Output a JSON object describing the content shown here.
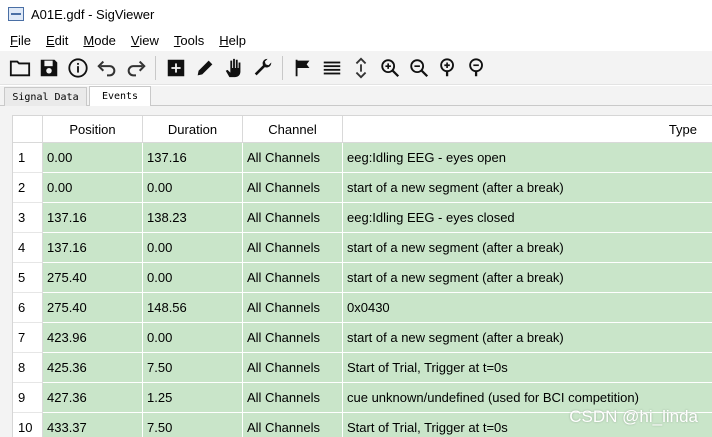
{
  "window": {
    "title": "A01E.gdf - SigViewer"
  },
  "menubar": {
    "items": [
      {
        "label": "File",
        "accel": "F",
        "rest": "ile"
      },
      {
        "label": "Edit",
        "accel": "E",
        "rest": "dit"
      },
      {
        "label": "Mode",
        "accel": "M",
        "rest": "ode"
      },
      {
        "label": "View",
        "accel": "V",
        "rest": "iew"
      },
      {
        "label": "Tools",
        "accel": "T",
        "rest": "ools"
      },
      {
        "label": "Help",
        "accel": "H",
        "rest": "elp"
      }
    ]
  },
  "toolbar": {
    "buttons": [
      "open-folder-icon",
      "save-icon",
      "info-icon",
      "undo-icon",
      "redo-icon",
      "add-event-icon",
      "pencil-icon",
      "hand-icon",
      "wrench-icon",
      "flag-icon",
      "list-icon",
      "vertical-scale-icon",
      "zoom-in-vertical-icon",
      "zoom-out-vertical-icon",
      "zoom-in-icon",
      "zoom-out-icon"
    ]
  },
  "tabs": [
    {
      "label": "Signal Data",
      "active": false
    },
    {
      "label": "Events",
      "active": true
    }
  ],
  "events_table": {
    "columns": [
      "Position",
      "Duration",
      "Channel",
      "Type"
    ],
    "rows": [
      {
        "num": "1",
        "position": "0.00",
        "duration": "137.16",
        "channel": "All Channels",
        "type": "eeg:Idling EEG - eyes open"
      },
      {
        "num": "2",
        "position": "0.00",
        "duration": "0.00",
        "channel": "All Channels",
        "type": "start of a new segment (after a break)"
      },
      {
        "num": "3",
        "position": "137.16",
        "duration": "138.23",
        "channel": "All Channels",
        "type": "eeg:Idling EEG - eyes closed"
      },
      {
        "num": "4",
        "position": "137.16",
        "duration": "0.00",
        "channel": "All Channels",
        "type": "start of a new segment (after a break)"
      },
      {
        "num": "5",
        "position": "275.40",
        "duration": "0.00",
        "channel": "All Channels",
        "type": "start of a new segment (after a break)"
      },
      {
        "num": "6",
        "position": "275.40",
        "duration": "148.56",
        "channel": "All Channels",
        "type": "0x0430"
      },
      {
        "num": "7",
        "position": "423.96",
        "duration": "0.00",
        "channel": "All Channels",
        "type": "start of a new segment (after a break)"
      },
      {
        "num": "8",
        "position": "425.36",
        "duration": "7.50",
        "channel": "All Channels",
        "type": "Start of Trial, Trigger at t=0s"
      },
      {
        "num": "9",
        "position": "427.36",
        "duration": "1.25",
        "channel": "All Channels",
        "type": "cue unknown/undefined (used for BCI competition)"
      },
      {
        "num": "10",
        "position": "433.37",
        "duration": "7.50",
        "channel": "All Channels",
        "type": "Start of Trial, Trigger at t=0s"
      }
    ]
  },
  "watermark": "CSDN @hi_linda",
  "colors": {
    "row_fill": "#c9e5c9",
    "toolbar_bg": "#f3f3f3"
  }
}
